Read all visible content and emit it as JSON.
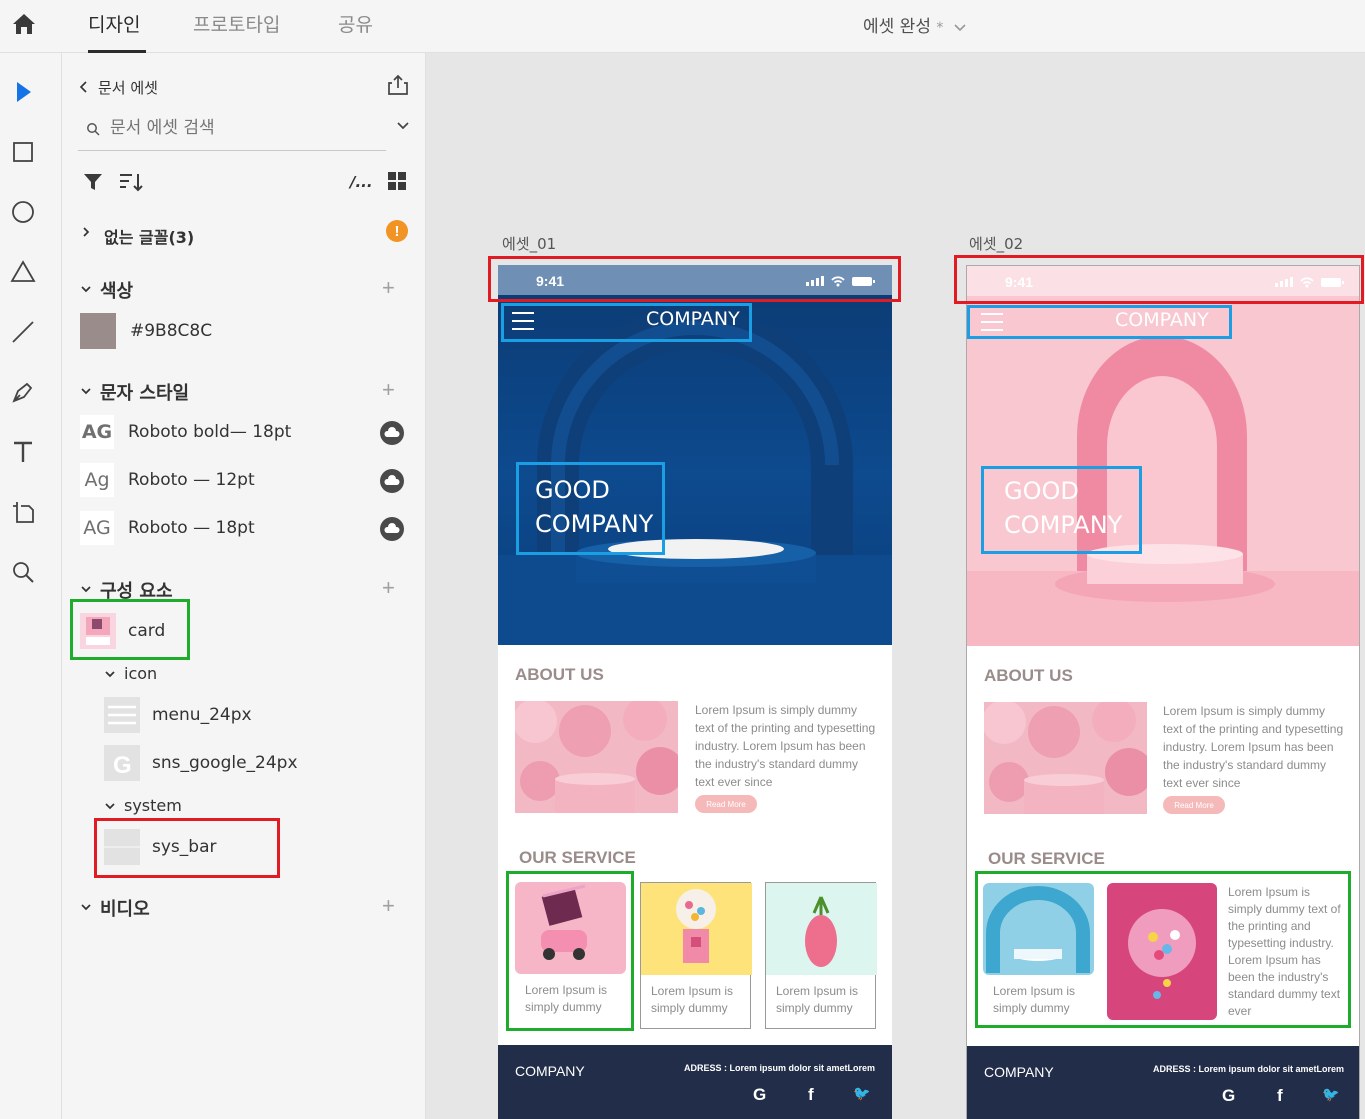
{
  "tabs": [
    {
      "label": "디자인",
      "active": true
    },
    {
      "label": "프로토타입",
      "active": false
    },
    {
      "label": "공유",
      "active": false
    }
  ],
  "document": {
    "title": "에셋 완성",
    "unsaved_mark": "*"
  },
  "panel": {
    "back_label": "문서 에셋",
    "search_placeholder": "문서 에셋 검색",
    "path_toggle": "/...",
    "missing_fonts": "없는 글꼴(3)",
    "colors": {
      "title": "색상",
      "items": [
        {
          "hex": "#9B8C8C"
        }
      ]
    },
    "char_styles": {
      "title": "문자 스타일",
      "items": [
        {
          "preview": "AG",
          "label": "Roboto bold— 18pt"
        },
        {
          "preview": "Ag",
          "label": "Roboto — 12pt"
        },
        {
          "preview": "AG",
          "label": "Roboto — 18pt"
        }
      ]
    },
    "components": {
      "title": "구성 요소",
      "card": "card",
      "group_icon": "icon",
      "menu_icon": "menu_24px",
      "google_icon": "sns_google_24px",
      "group_system": "system",
      "sys_bar": "sys_bar"
    },
    "video": {
      "title": "비디오"
    }
  },
  "artboards": [
    {
      "label": "에셋_01",
      "time": "9:41",
      "company": "COMPANY",
      "hero_line1": "GOOD",
      "hero_line2": "COMPANY",
      "about_title": "ABOUT US",
      "about_text": "Lorem Ipsum is simply dummy text of the printing and typesetting industry. Lorem Ipsum has been the industry's standard dummy text ever since",
      "read_more": "Read More",
      "service_title": "OUR SERVICE",
      "card_caption": "Lorem Ipsum is simply dummy",
      "footer_company": "COMPANY",
      "footer_address": "ADRESS : Lorem ipsum dolor sit ametLorem"
    },
    {
      "label": "에셋_02",
      "time": "9:41",
      "company": "COMPANY",
      "hero_line1": "GOOD",
      "hero_line2": "COMPANY",
      "about_title": "ABOUT US",
      "about_text": "Lorem Ipsum is simply dummy text of the printing and typesetting industry. Lorem Ipsum has been the industry's standard dummy text ever since",
      "read_more": "Read More",
      "service_title": "OUR SERVICE",
      "card_caption": "Lorem Ipsum is simply dummy",
      "wide_card_text": "Lorem Ipsum is simply dummy text of the printing and typesetting industry. Lorem Ipsum has been the industry's standard dummy text ever",
      "footer_company": "COMPANY",
      "footer_address": "ADRESS : Lorem ipsum dolor sit ametLorem"
    }
  ],
  "footer_icons": [
    "G",
    "f",
    "🐦"
  ],
  "colors": {
    "brand_brown": "#9B8C8C",
    "hero_blue": "#0d4a8e",
    "hero_pink": "#f9c7cf",
    "footer_navy": "#222e49",
    "annot_red": "#e01b24",
    "annot_blue": "#1a9ee4",
    "annot_green": "#1fab2c"
  }
}
